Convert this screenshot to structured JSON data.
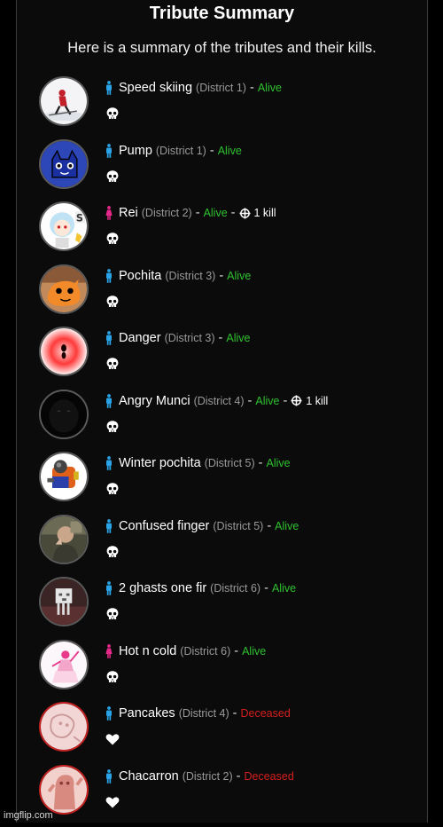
{
  "header": {
    "title": "Tribute Summary",
    "subtitle": "Here is a summary of the tributes and their kills."
  },
  "colors": {
    "alive": "#2fc12f",
    "deceased": "#d61e1e",
    "male": "#2aa4e6",
    "female": "#e8288a"
  },
  "tributes": [
    {
      "name": "Speed skiing",
      "district": "(District 1)",
      "separator": "-",
      "status": "Alive",
      "gender": "male",
      "kills": "",
      "state_icon": "skull-icon"
    },
    {
      "name": "Pump",
      "district": "(District 1)",
      "separator": "-",
      "status": "Alive",
      "gender": "male",
      "kills": "",
      "state_icon": "skull-icon"
    },
    {
      "name": "Rei",
      "district": "(District 2)",
      "separator": "-",
      "status": "Alive",
      "gender": "female",
      "kills": "1 kill",
      "kills_separator": "-",
      "state_icon": "skull-icon"
    },
    {
      "name": "Pochita",
      "district": "(District 3)",
      "separator": "-",
      "status": "Alive",
      "gender": "male",
      "kills": "",
      "state_icon": "skull-icon"
    },
    {
      "name": "Danger",
      "district": "(District 3)",
      "separator": "-",
      "status": "Alive",
      "gender": "male",
      "kills": "",
      "state_icon": "skull-icon"
    },
    {
      "name": "Angry Munci",
      "district": "(District 4)",
      "separator": "-",
      "status": "Alive",
      "gender": "male",
      "kills": "1 kill",
      "kills_separator": "-",
      "state_icon": "skull-icon"
    },
    {
      "name": "Winter pochita",
      "district": "(District 5)",
      "separator": "-",
      "status": "Alive",
      "gender": "male",
      "kills": "",
      "state_icon": "skull-icon"
    },
    {
      "name": "Confused finger",
      "district": "(District 5)",
      "separator": "-",
      "status": "Alive",
      "gender": "male",
      "kills": "",
      "state_icon": "skull-icon"
    },
    {
      "name": "2 ghasts one fir",
      "district": "(District 6)",
      "separator": "-",
      "status": "Alive",
      "gender": "male",
      "kills": "",
      "state_icon": "skull-icon"
    },
    {
      "name": "Hot n cold",
      "district": "(District 6)",
      "separator": "-",
      "status": "Alive",
      "gender": "female",
      "kills": "",
      "state_icon": "skull-icon"
    },
    {
      "name": "Pancakes",
      "district": "(District 4)",
      "separator": "-",
      "status": "Deceased",
      "gender": "male",
      "kills": "",
      "state_icon": "heart-icon"
    },
    {
      "name": "Chacarron",
      "district": "(District 2)",
      "separator": "-",
      "status": "Deceased",
      "gender": "male",
      "kills": "",
      "state_icon": "heart-icon"
    }
  ],
  "watermark": "imgflip.com"
}
